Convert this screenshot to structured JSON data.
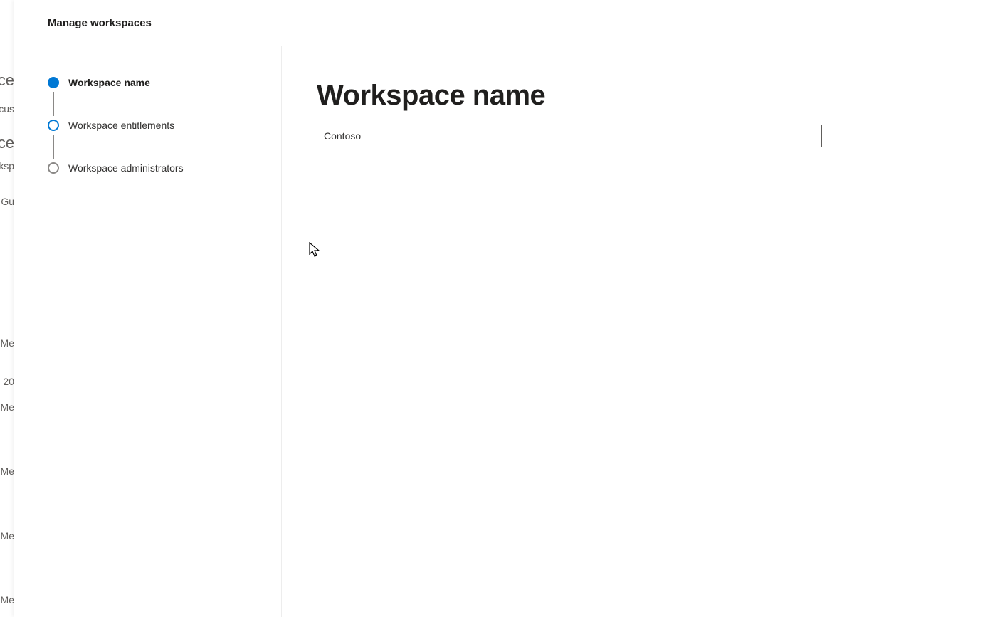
{
  "background": {
    "items": [
      "ce",
      "cus",
      "ce",
      "rksp",
      "Gu",
      "Me",
      "20",
      "Me",
      "Me",
      "Me",
      "Me"
    ]
  },
  "panel": {
    "title": "Manage workspaces"
  },
  "stepper": {
    "steps": [
      {
        "label": "Workspace name",
        "state": "active"
      },
      {
        "label": "Workspace entitlements",
        "state": "next"
      },
      {
        "label": "Workspace administrators",
        "state": "pending"
      }
    ]
  },
  "main": {
    "heading": "Workspace name",
    "input_value": "Contoso"
  }
}
